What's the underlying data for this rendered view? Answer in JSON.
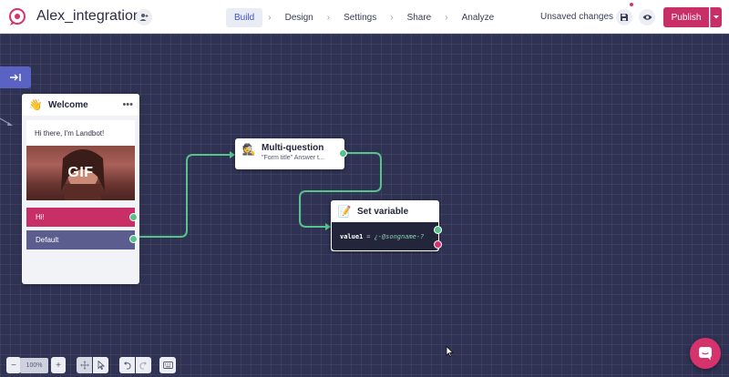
{
  "app": {
    "title": "Alex_integration"
  },
  "nav": {
    "tabs": [
      {
        "label": "Build",
        "active": true
      },
      {
        "label": "Design",
        "active": false
      },
      {
        "label": "Settings",
        "active": false
      },
      {
        "label": "Share",
        "active": false
      },
      {
        "label": "Analyze",
        "active": false
      }
    ],
    "separator": "›"
  },
  "header": {
    "status": "Unsaved changes",
    "publish_label": "Publish"
  },
  "nodes": {
    "welcome": {
      "title": "Welcome",
      "emoji": "👋",
      "menu": "•••",
      "message": "Hi there, I'm Landbot!",
      "gif_label": "GIF",
      "buttons": [
        "Hi!",
        "Default"
      ]
    },
    "multi_question": {
      "title": "Multi-question",
      "emoji": "🕵",
      "subtitle": "\"Form title\" Answer t..."
    },
    "set_variable": {
      "title": "Set variable",
      "emoji": "📝",
      "variable": "value1",
      "operator": "=",
      "value": "¿-@songname-?"
    }
  },
  "toolbar": {
    "zoom_out": "−",
    "zoom_level": "100%",
    "zoom_in": "+"
  },
  "colors": {
    "canvas": "#2f3253",
    "brand_pink": "#c72f66",
    "connector_green": "#55c48a",
    "button_default": "#5a5d8e"
  },
  "icons": {
    "logo": "landbot-pin-icon",
    "share_user": "add-user-icon",
    "save": "save-icon",
    "preview": "eye-icon",
    "start": "arrow-to-line-icon",
    "chat": "chat-icon"
  }
}
